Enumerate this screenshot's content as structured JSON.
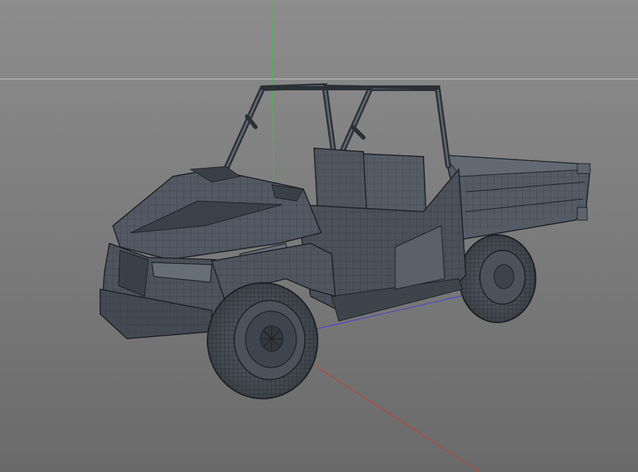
{
  "app": {
    "title": ""
  },
  "viewport": {
    "background_top": "#8d8d8d",
    "background_bottom": "#6a6a6a",
    "horizon_color": "#c9c9c9",
    "axis_colors": {
      "x": "#d23a2a",
      "y": "#39c43a",
      "z": "#4040d8"
    },
    "display_mode": "wireframe-on-shaded",
    "model": {
      "name": "",
      "body_color": "#4f5660",
      "edge_color": "#1c1f23",
      "highlight_color": "#6b727c"
    }
  }
}
